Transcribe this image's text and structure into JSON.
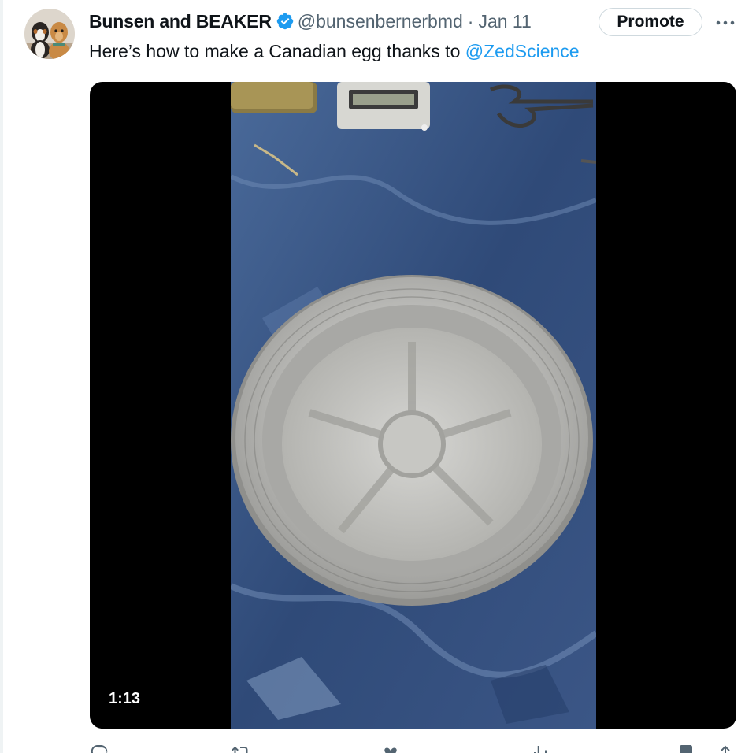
{
  "tweet": {
    "author": {
      "display_name": "Bunsen and BEAKER",
      "handle": "@bunsenbernerbmd",
      "verified_icon": "verified-badge-icon",
      "avatar_icon": "avatar-photo"
    },
    "date_separator": "·",
    "date": "Jan 11",
    "promote_label": "Promote",
    "more_icon": "more-dots-icon",
    "text_prefix": "Here’s how to make a Canadian egg thanks to ",
    "mention": "@ZedScience",
    "media": {
      "type": "video",
      "duration": "1:13"
    },
    "actions": [
      {
        "name": "reply",
        "icon": "reply-icon",
        "count": ""
      },
      {
        "name": "retweet",
        "icon": "retweet-icon",
        "count": ""
      },
      {
        "name": "like",
        "icon": "heart-icon",
        "count": ""
      },
      {
        "name": "views",
        "icon": "views-icon",
        "count": ""
      },
      {
        "name": "bookmark",
        "icon": "bookmark-icon",
        "count": ""
      },
      {
        "name": "share",
        "icon": "share-icon",
        "count": ""
      }
    ]
  },
  "colors": {
    "link": "#1d9bf0",
    "text": "#0f1419",
    "secondary_text": "#536471",
    "verified": "#1d9bf0",
    "media_background": "#000000"
  }
}
